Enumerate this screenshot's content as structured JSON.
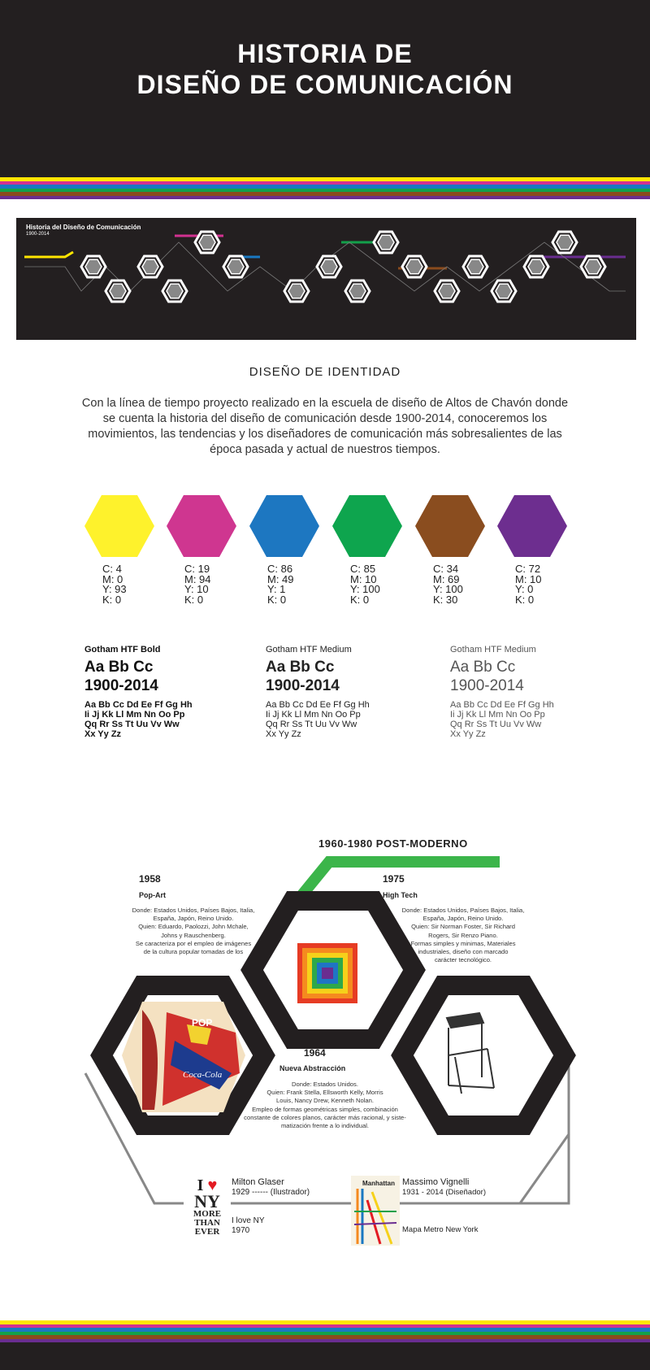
{
  "header": {
    "title_line1": "HISTORIA DE",
    "title_line2": "DISEÑO DE COMUNICACIÓN"
  },
  "stripe_colors": [
    "#ffe600",
    "#d23190",
    "#1978c2",
    "#13a04a",
    "#8a4b1d",
    "#6a2d90"
  ],
  "timeline_thumb": {
    "title": "Historia del Diseño de Comunicación",
    "subtitle": "1900-2014"
  },
  "identity": {
    "title": "DISEÑO DE IDENTIDAD",
    "intro": "Con la línea de tiempo  proyecto realizado en la escuela de diseño de Altos de Chavón donde se cuenta la historia del diseño de comunicación desde 1900-2014, conoceremos los movimientos, las tendencias y los diseñadores de comunicación más sobresalientes de las época pasada y actual de nuestros tiempos."
  },
  "swatches": [
    {
      "hex": "#fef22c",
      "c": "C:  4",
      "m": "M: 0",
      "y": "Y:  93",
      "k": "K:  0"
    },
    {
      "hex": "#cf3690",
      "c": "C:  19",
      "m": "M: 94",
      "y": "Y: 10",
      "k": "K:  0"
    },
    {
      "hex": "#1d77c1",
      "c": "C:  86",
      "m": "M: 49",
      "y": "Y:  1",
      "k": "K:  0"
    },
    {
      "hex": "#0ea54e",
      "c": "C:  85",
      "m": "M: 10",
      "y": "Y:  100",
      "k": "K:  0"
    },
    {
      "hex": "#8a4d1f",
      "c": "C:  34",
      "m": "M: 69",
      "y": "Y:  100",
      "k": "K:  30"
    },
    {
      "hex": "#6d2e8f",
      "c": "C:  72",
      "m": "M: 10",
      "y": "Y:  0",
      "k": "K:  0"
    }
  ],
  "fonts": [
    {
      "name": "Gotham HTF Bold",
      "sample": "Aa Bb Cc",
      "years": "1900-2014",
      "l1": "Aa Bb Cc Dd Ee Ff Gg Hh",
      "l2": "Ii Jj Kk Ll Mm Nn Oo Pp",
      "l3": "Qq Rr Ss Tt Uu Vv Ww",
      "l4": "Xx Yy Zz"
    },
    {
      "name": "Gotham HTF Medium",
      "sample": "Aa Bb Cc",
      "years": "1900-2014",
      "l1": "Aa Bb Cc Dd Ee Ff Gg Hh",
      "l2": "Ii Jj Kk Ll Mm Nn Oo Pp",
      "l3": "Qq Rr Ss Tt Uu Vv Ww",
      "l4": "Xx Yy Zz"
    },
    {
      "name": "Gotham HTF Medium",
      "sample": "Aa Bb Cc",
      "years": "1900-2014",
      "l1": "Aa Bb Cc Dd Ee Ff Gg Hh",
      "l2": "Ii Jj Kk Ll Mm Nn Oo Pp",
      "l3": "Qq Rr Ss Tt Uu Vv Ww",
      "l4": "Xx Yy Zz"
    }
  ],
  "detail": {
    "era": "1960-1980  POST-MODERNO",
    "popart": {
      "year": "1958",
      "movement": "Pop-Art",
      "d1": "Donde: Estados Unidos, Países Bajos, Italia,",
      "d2": "España, Japón, Reino Unido.",
      "d3": "Quien: Eduardo, Paolozzi, John Mchale,",
      "d4": "Johns y Rauschenberg.",
      "d5": "Se caracteriza por el empleo de imágenes",
      "d6": "de la cultura popular tomadas de los"
    },
    "hightech": {
      "year": "1975",
      "movement": "High Tech",
      "d1": "Donde: Estados Unidos, Países Bajos, Italia,",
      "d2": "España, Japón, Reino Unido.",
      "d3": "Quien: Sir Norman Foster, Sir Richard",
      "d4": "Rogers, Sir Renzo Piano.",
      "d5": "Formas  simples  y  minimas,  Materiales",
      "d6": "industriales, diseño con marcado",
      "d7": "carácter tecnológico."
    },
    "abstraction": {
      "year": "1964",
      "movement": "Nueva Abstracción",
      "d1": "Donde: Estados Unidos.",
      "d2": "Quien: Frank Stella,  Ellsworth Kelly, Morris",
      "d3": "Louis, Nancy Drew, Kenneth Nolan.",
      "d4": "Empleo de formas geométricas simples, combinación",
      "d5": "constante de colores planos, carácter más racional, y siste-",
      "d6": "matización frente a lo individual."
    },
    "glaser": {
      "name": "Milton Glaser",
      "dates": "1929 ------ (Ilustrador)",
      "work": "I love NY",
      "year": "1970",
      "logo_i": "I",
      "logo_ny": "NY",
      "logo_more": "MORE",
      "logo_than": "THAN",
      "logo_ever": "EVER"
    },
    "vignelli": {
      "name": "Massimo Vignelli",
      "dates": "1931 - 2014 (Diseñador)",
      "work": "Mapa Metro New York",
      "map_label": "Manhattan"
    },
    "coke_label": "Coca-Cola",
    "pop_label": "POP"
  }
}
